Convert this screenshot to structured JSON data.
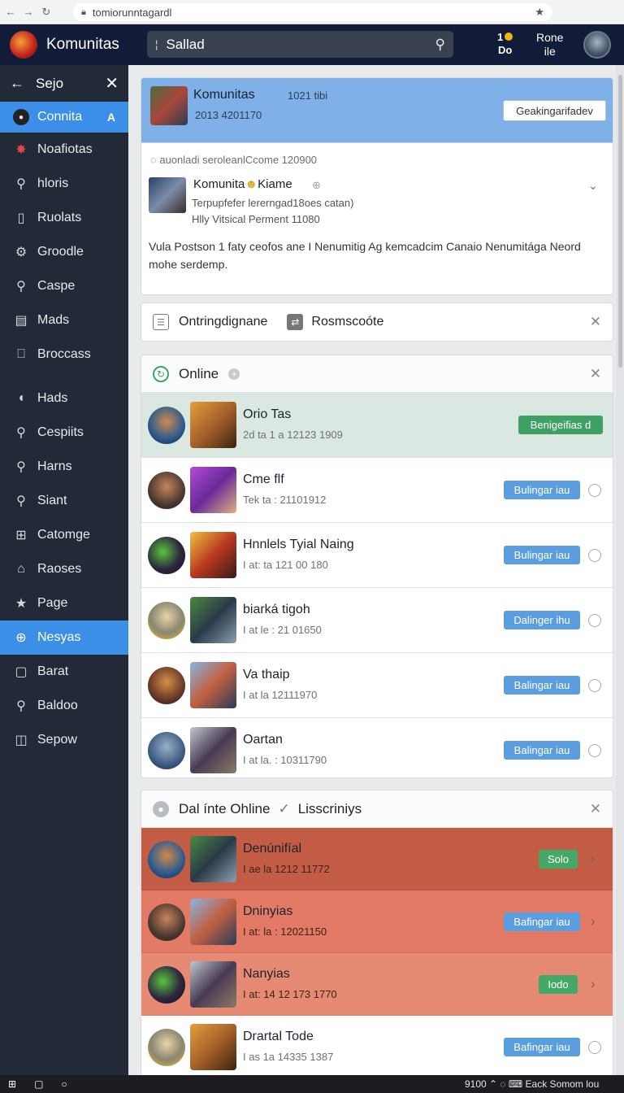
{
  "browser": {
    "url": "tomiorunntagardl"
  },
  "appbar": {
    "brand": "Komunitas",
    "search_value": "Sallad",
    "coin_count": "1",
    "coin_label": "Do",
    "user_line1": "Rone",
    "user_line2": "ile"
  },
  "sidebar": {
    "title": "Sejo",
    "items": [
      {
        "label": "Connita",
        "icon": "community-icon",
        "glyph": "●",
        "badge": "A",
        "active": true
      },
      {
        "label": "Noafiotas",
        "icon": "burst-icon",
        "glyph": "✸"
      },
      {
        "label": "hloris",
        "icon": "search-icon",
        "glyph": "⚲"
      },
      {
        "label": "Ruolats",
        "icon": "document-icon",
        "glyph": "▯"
      },
      {
        "label": "Groodle",
        "icon": "gear-icon",
        "glyph": "⚙"
      },
      {
        "label": "Caspe",
        "icon": "search-icon",
        "glyph": "⚲"
      },
      {
        "label": "Mads",
        "icon": "map-icon",
        "glyph": "▤"
      },
      {
        "label": "Broccass",
        "icon": "bookmark-icon",
        "glyph": "⎕"
      },
      {
        "label": "Hads",
        "icon": "pin-icon",
        "glyph": "◖"
      },
      {
        "label": "Cespiits",
        "icon": "search-icon",
        "glyph": "⚲"
      },
      {
        "label": "Harns",
        "icon": "magnify-icon",
        "glyph": "⚲"
      },
      {
        "label": "Siant",
        "icon": "magnify-icon",
        "glyph": "⚲"
      },
      {
        "label": "Catomge",
        "icon": "grid-icon",
        "glyph": "⊞"
      },
      {
        "label": "Raoses",
        "icon": "folder-icon",
        "glyph": "⌂"
      },
      {
        "label": "Page",
        "icon": "star-icon",
        "glyph": "★"
      },
      {
        "label": "Nesyas",
        "icon": "globe-icon",
        "glyph": "⊕",
        "active": true
      },
      {
        "label": "Barat",
        "icon": "square-icon",
        "glyph": "▢"
      },
      {
        "label": "Baldoo",
        "icon": "magnify-icon",
        "glyph": "⚲"
      },
      {
        "label": "Sepow",
        "icon": "book-icon",
        "glyph": "◫"
      }
    ]
  },
  "group": {
    "name": "Komunitas",
    "id": "1021 tibi",
    "meta": "2013 4201170",
    "follow_label": "Geakingarifadev",
    "subline": "auonladi seroleanlCcome 120900",
    "game_name": "Komunita",
    "game_name2": "Kiame",
    "game_line1": "Terpupfefer lererngad18oes catan)",
    "game_line2": "Hlly Vitsical Perment 11080",
    "description": "Vula Postson 1 faty ceofos ane I Nenumitig Ag kemcadcim Canaio Nenumitága Neord mohe serdemp."
  },
  "filter_bar": {
    "label1": "Ontringdignane",
    "label2": "Rosmscoóte"
  },
  "online": {
    "title": "Online",
    "rows": [
      {
        "name": "Orio Tas",
        "sub": "2d ta 1 a 12123 1909",
        "button": "Benigeifias d",
        "button_color": "#3fa066",
        "highlight": true
      },
      {
        "name": "Cme flf",
        "sub": "Tek ta : 21101912",
        "button": "Bulingar iau",
        "button_color": "#5b9ee0"
      },
      {
        "name": "Hnnlels Tyial Naing",
        "sub": "I at: ta 121 00 180",
        "button": "Bulingar iau",
        "button_color": "#5b9ee0"
      },
      {
        "name": "biarká tigoh",
        "sub": "I at le : 21 01650",
        "button": "Dalinger ihu",
        "button_color": "#5b9ee0"
      },
      {
        "name": "Va thaip",
        "sub": "I at la 12111970",
        "button": "Balingar iau",
        "button_color": "#5b9ee0"
      },
      {
        "name": "Oartan",
        "sub": "I at la. : 10311790",
        "button": "Balingar iau",
        "button_color": "#5b9ee0"
      }
    ]
  },
  "offline": {
    "title": "Dal ínte Ohline",
    "title2": "Lisscriniys",
    "rows": [
      {
        "name": "Denúnifíal",
        "sub": "I ae la 1212 11772",
        "button": "Solo",
        "button_color": "#46a866",
        "bg": "#c25c45"
      },
      {
        "name": "Dninyias",
        "sub": "I at: la : 12021150",
        "button": "Bafingar iau",
        "button_color": "#5b9ee0",
        "bg": "#e37a65"
      },
      {
        "name": "Nanyias",
        "sub": "I at: 14 12 173 1770",
        "button": "Iodo",
        "button_color": "#46a866",
        "bg": "#e68a73"
      },
      {
        "name": "Drartal Tode",
        "sub": "I as 1a 14335 1387",
        "button": "Bafingar iau",
        "button_color": "#5b9ee0",
        "bg": "#ffffff"
      }
    ]
  },
  "taskbar": {
    "status": "9100",
    "right": "Eack Somom lou"
  }
}
